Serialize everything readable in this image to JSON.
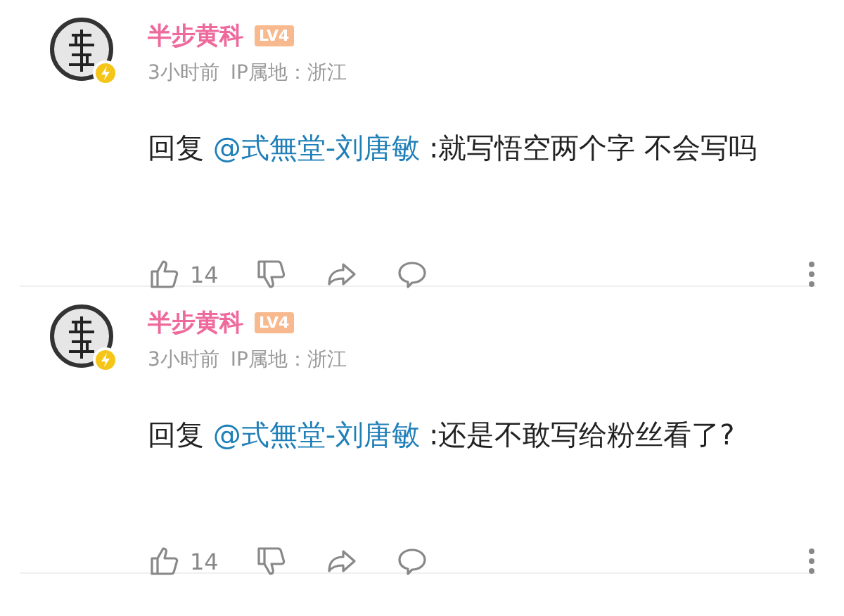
{
  "comments": [
    {
      "author": "半步黄科",
      "level_badge": "LV4",
      "time": "3小时前",
      "ip_location": "IP属地：浙江",
      "reply_prefix": "回复",
      "mention": "@式無堂-刘唐敏",
      "body": ":就写悟空两个字 不会写吗",
      "likes": "14"
    },
    {
      "author": "半步黄科",
      "level_badge": "LV4",
      "time": "3小时前",
      "ip_location": "IP属地：浙江",
      "reply_prefix": "回复",
      "mention": "@式無堂-刘唐敏",
      "body": ":还是不敢写给粉丝看了?",
      "likes": "14"
    }
  ]
}
